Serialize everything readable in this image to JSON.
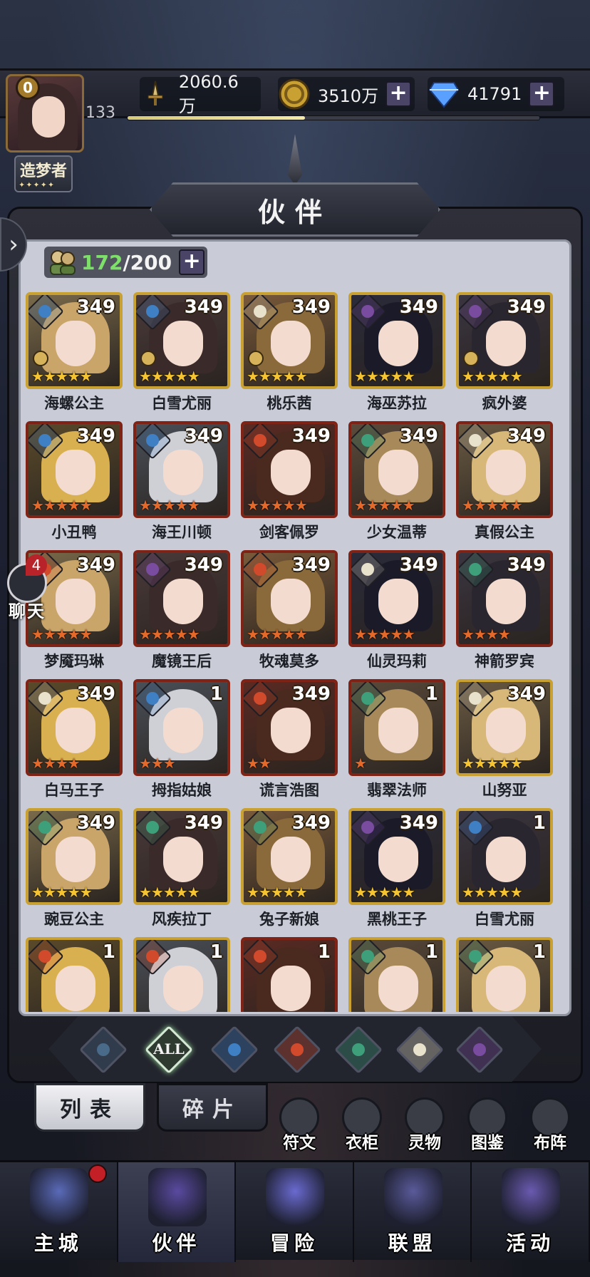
{
  "player": {
    "level_badge": "0",
    "level": "133",
    "rank_title": "造梦者",
    "rank_stars": "✦✦✦✦✦",
    "xp_progress": 0.43
  },
  "resources": {
    "power": "2060.6万",
    "gold": "3510万",
    "diamonds": "41791",
    "plus": "+"
  },
  "page": {
    "title": "伙伴",
    "capacity_current": "172",
    "capacity_max": "/200",
    "capacity_plus": "+"
  },
  "chat": {
    "count": "4",
    "label": "聊天"
  },
  "side_arrow": "›",
  "elements": {
    "water": "#3f7fc4",
    "fire": "#d24a2c",
    "wind": "#3ea07a",
    "light": "#e8e2cc",
    "dark": "#7a4ca0",
    "all": "#d6e8d6"
  },
  "heroes": [
    {
      "name": "海螺公主",
      "level": "349",
      "element": "water",
      "rarity": "gold",
      "stars": "★★★★★",
      "crown": true
    },
    {
      "name": "白雪尤丽",
      "level": "349",
      "element": "water",
      "rarity": "gold",
      "stars": "★★★★★",
      "crown": true
    },
    {
      "name": "桃乐茜",
      "level": "349",
      "element": "light",
      "rarity": "gold",
      "stars": "★★★★★",
      "crown": true
    },
    {
      "name": "海巫苏拉",
      "level": "349",
      "element": "dark",
      "rarity": "gold",
      "stars": "★★★★★",
      "crown": false
    },
    {
      "name": "疯外婆",
      "level": "349",
      "element": "dark",
      "rarity": "gold",
      "stars": "★★★★★",
      "crown": true
    },
    {
      "name": "小丑鸭",
      "level": "349",
      "element": "water",
      "rarity": "red",
      "stars": "★★★★★",
      "crown": false
    },
    {
      "name": "海王川顿",
      "level": "349",
      "element": "water",
      "rarity": "red",
      "stars": "★★★★★",
      "crown": false
    },
    {
      "name": "剑客佩罗",
      "level": "349",
      "element": "fire",
      "rarity": "red",
      "stars": "★★★★★",
      "crown": false
    },
    {
      "name": "少女温蒂",
      "level": "349",
      "element": "wind",
      "rarity": "red",
      "stars": "★★★★★",
      "crown": false
    },
    {
      "name": "真假公主",
      "level": "349",
      "element": "light",
      "rarity": "red",
      "stars": "★★★★★",
      "crown": false
    },
    {
      "name": "梦魇玛琳",
      "level": "349",
      "element": "fire",
      "rarity": "red",
      "stars": "★★★★★",
      "crown": false
    },
    {
      "name": "魔镜王后",
      "level": "349",
      "element": "dark",
      "rarity": "red",
      "stars": "★★★★★",
      "crown": false
    },
    {
      "name": "牧魂莫多",
      "level": "349",
      "element": "fire",
      "rarity": "red",
      "stars": "★★★★★",
      "crown": false
    },
    {
      "name": "仙灵玛莉",
      "level": "349",
      "element": "light",
      "rarity": "red",
      "stars": "★★★★★",
      "crown": false
    },
    {
      "name": "神箭罗宾",
      "level": "349",
      "element": "wind",
      "rarity": "red",
      "stars": "★★★★",
      "crown": false
    },
    {
      "name": "白马王子",
      "level": "349",
      "element": "light",
      "rarity": "red",
      "stars": "★★★★",
      "crown": false
    },
    {
      "name": "拇指姑娘",
      "level": "1",
      "element": "water",
      "rarity": "red",
      "stars": "★★★",
      "crown": false
    },
    {
      "name": "谎言浩图",
      "level": "349",
      "element": "fire",
      "rarity": "red",
      "stars": "★★",
      "crown": false
    },
    {
      "name": "翡翠法师",
      "level": "1",
      "element": "wind",
      "rarity": "red",
      "stars": "★",
      "crown": false
    },
    {
      "name": "山努亚",
      "level": "349",
      "element": "light",
      "rarity": "gold",
      "stars": "★★★★★",
      "crown": false
    },
    {
      "name": "豌豆公主",
      "level": "349",
      "element": "wind",
      "rarity": "gold",
      "stars": "★★★★★",
      "crown": false
    },
    {
      "name": "风疾拉丁",
      "level": "349",
      "element": "wind",
      "rarity": "gold",
      "stars": "★★★★★",
      "crown": false
    },
    {
      "name": "兔子新娘",
      "level": "349",
      "element": "wind",
      "rarity": "gold",
      "stars": "★★★★★",
      "crown": false
    },
    {
      "name": "黑桃王子",
      "level": "349",
      "element": "dark",
      "rarity": "gold",
      "stars": "★★★★★",
      "crown": false
    },
    {
      "name": "白雪尤丽",
      "level": "1",
      "element": "water",
      "rarity": "gold",
      "stars": "★★★★★",
      "crown": false
    },
    {
      "name": "",
      "level": "1",
      "element": "fire",
      "rarity": "gold",
      "stars": "",
      "crown": false
    },
    {
      "name": "",
      "level": "1",
      "element": "fire",
      "rarity": "gold",
      "stars": "",
      "crown": false
    },
    {
      "name": "",
      "level": "1",
      "element": "fire",
      "rarity": "red",
      "stars": "",
      "crown": false
    },
    {
      "name": "",
      "level": "1",
      "element": "wind",
      "rarity": "gold",
      "stars": "",
      "crown": false
    },
    {
      "name": "",
      "level": "1",
      "element": "wind",
      "rarity": "gold",
      "stars": "",
      "crown": false
    }
  ],
  "filters": [
    {
      "key": "none",
      "label": ""
    },
    {
      "key": "all",
      "label": "ALL"
    },
    {
      "key": "water",
      "label": ""
    },
    {
      "key": "fire",
      "label": ""
    },
    {
      "key": "wind",
      "label": ""
    },
    {
      "key": "light",
      "label": ""
    },
    {
      "key": "dark",
      "label": ""
    }
  ],
  "tabs": {
    "list": "列表",
    "fragments": "碎片"
  },
  "small_buttons": [
    {
      "key": "rune",
      "label": "符文"
    },
    {
      "key": "wardrobe",
      "label": "衣柜"
    },
    {
      "key": "spirit",
      "label": "灵物"
    },
    {
      "key": "codex",
      "label": "图鉴"
    },
    {
      "key": "formation",
      "label": "布阵"
    }
  ],
  "nav": [
    {
      "key": "main-city",
      "label": "主城"
    },
    {
      "key": "partners",
      "label": "伙伴"
    },
    {
      "key": "adventure",
      "label": "冒险"
    },
    {
      "key": "alliance",
      "label": "联盟"
    },
    {
      "key": "events",
      "label": "活动"
    }
  ]
}
